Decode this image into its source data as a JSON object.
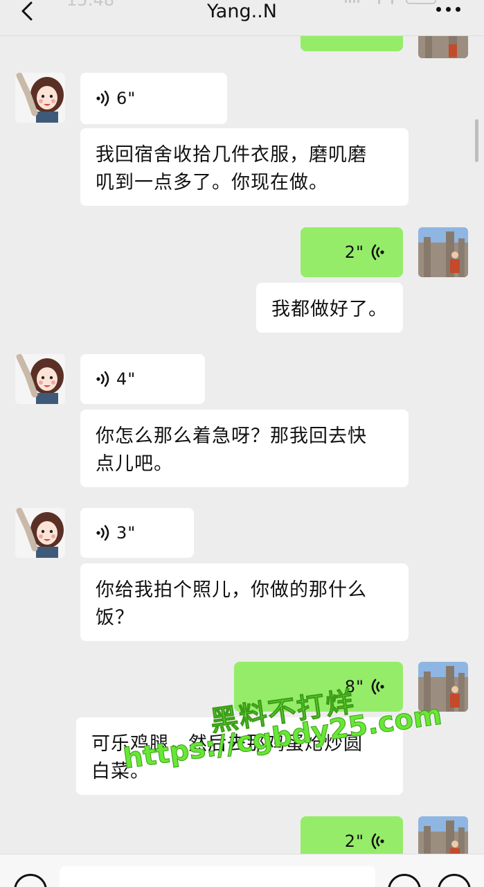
{
  "status_bar": {
    "time": "15:48"
  },
  "header": {
    "title": "Yang..N"
  },
  "messages": [
    {
      "side": "right",
      "type": "voice",
      "duration": ""
    },
    {
      "side": "left",
      "type": "voice",
      "duration": "6\""
    },
    {
      "side": "left",
      "type": "text",
      "lines": [
        "我回宿舍收拾几件衣服，磨叽磨",
        "叽到一点多了。你现在做。"
      ]
    },
    {
      "side": "right",
      "type": "voice",
      "duration": "2\""
    },
    {
      "side": "right",
      "type": "text",
      "lines": [
        "我都做好了。"
      ]
    },
    {
      "side": "left",
      "type": "voice",
      "duration": "4\""
    },
    {
      "side": "left",
      "type": "text",
      "lines": [
        "你怎么那么着急呀？那我回去快",
        "点儿吧。"
      ]
    },
    {
      "side": "left",
      "type": "voice",
      "duration": "3\""
    },
    {
      "side": "left",
      "type": "text",
      "lines": [
        "你给我拍个照儿，你做的那什么",
        "饭？"
      ]
    },
    {
      "side": "right",
      "type": "voice",
      "duration": "8\""
    },
    {
      "side": "right",
      "type": "text",
      "lines": [
        "可乐鸡腿，然后去那鸡蛋炝炒圆",
        "白菜。"
      ]
    },
    {
      "side": "right",
      "type": "voice",
      "duration": "2\""
    }
  ],
  "watermark": {
    "line1": "黑料不打烊",
    "line2": "https://cgbdy25.com"
  },
  "colors": {
    "bubble_green": "#95ec69",
    "bubble_white": "#ffffff",
    "background": "#ededed"
  },
  "icons": {
    "back": "chevron-left-icon",
    "more": "more-dots-icon",
    "voice_incoming": "voice-wave-icon",
    "voice_outgoing": "voice-wave-icon",
    "input_voice": "voice-mode-icon",
    "emoji": "emoji-icon",
    "plus": "plus-icon"
  }
}
